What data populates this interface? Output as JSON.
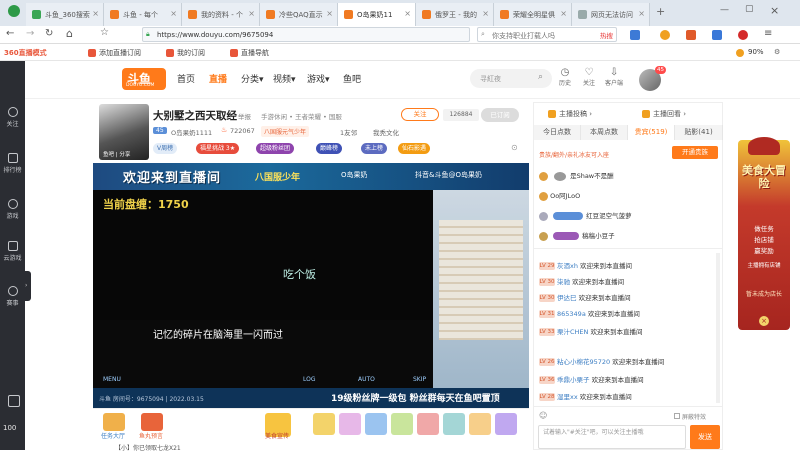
{
  "tabs": [
    {
      "label": "斗鱼_360搜索",
      "active": false,
      "color": "#3aa655"
    },
    {
      "label": "斗鱼 - 每个",
      "active": false,
      "color": "#f07a22"
    },
    {
      "label": "我的资料 - 个",
      "active": false,
      "color": "#f07a22"
    },
    {
      "label": "冷些QAQ直示",
      "active": false,
      "color": "#f07a22"
    },
    {
      "label": "O岛果奶11",
      "active": true,
      "color": "#f07a22"
    },
    {
      "label": "俄罗王 - 我的",
      "active": false,
      "color": "#f07a22"
    },
    {
      "label": "荣耀全明星俱",
      "active": false,
      "color": "#f07a22"
    },
    {
      "label": "网页无法访问",
      "active": false,
      "color": "#9aa"
    }
  ],
  "address": {
    "url": "https://www.douyu.com/9675094",
    "search_text": "你支持职业打载人吗",
    "search_hot": "热搜"
  },
  "bookmarks": [
    {
      "label": "360直播模式"
    },
    {
      "label": "添加直播订阅"
    },
    {
      "label": "我的订阅"
    },
    {
      "label": "直播导航"
    }
  ],
  "zoom": "90%",
  "left_sidebar": [
    {
      "label": "关注"
    },
    {
      "label": "排行榜"
    },
    {
      "label": "游戏"
    },
    {
      "label": "云游戏"
    },
    {
      "label": "赛事"
    }
  ],
  "sidebar_bottom": "100",
  "site": {
    "logo": "斗鱼",
    "logo_sub": "DOUYU.COM",
    "nav": [
      "首页",
      "直播",
      "分类▾",
      "视频▾",
      "游戏▾",
      "鱼吧"
    ],
    "search_placeholder": "寻紅夜",
    "icons": [
      "历史",
      "关注",
      "客户端"
    ],
    "avatar_badge": "45"
  },
  "room": {
    "title": "大别墅之西天取经",
    "report": "举报",
    "breadcrumb": "手游休闲 • 王者荣耀 • 国服",
    "streamer_level": "45",
    "streamer_name": "O岛果奶1111",
    "hot": "722067",
    "tag_rank": "八国服元气少年",
    "fan_club": "1友邻",
    "guild": "我秃文化",
    "follow_label": "关注",
    "follower_count": "126884",
    "followed_state": "已订阅",
    "badges": [
      "V周榜",
      "福星挑战 3★",
      "超级粉丝团",
      "巅峰榜",
      "未上榜",
      "仙石影遇"
    ],
    "streamer_tag": "鱼吧 | 分享"
  },
  "banner": {
    "main": "欢迎来到直播间",
    "right": "八国服少年",
    "tiktok": "O岛果奶",
    "douyu_id": "抖音&斗鱼@O岛果奶"
  },
  "video": {
    "gold": "当前盘缠：1750",
    "caption1": "吃个饭",
    "caption2": "记忆的碎片在脑海里一闪而过",
    "menu_items": [
      "MENU",
      "LOG",
      "AUTO",
      "SKIP"
    ]
  },
  "footbar": {
    "room_id": "斗鱼 房间号：9675094 | 2022.03.15",
    "slogan": "19级粉丝牌一级包  粉丝群每天在鱼吧置顶"
  },
  "gifts": {
    "left_items": [
      {
        "label": "任务大厅"
      },
      {
        "label": "鱼丸预言"
      }
    ],
    "mid_item": "美食宣传",
    "bottom_text": "【小】你已领取七龙X21"
  },
  "right_panel": {
    "top_tabs": [
      "主播投稿 ›",
      "主播回看 ›"
    ],
    "tabs": [
      "今日点数",
      "本周点数",
      "贵宾(519)",
      "贴影(41)"
    ],
    "banner_text": "贵族/翻外/亲礼冰友可入座",
    "open_vip": "开通贵族",
    "vips": [
      {
        "name": "是Shaw不是酬"
      },
      {
        "name": "Oo阿JLoO"
      },
      {
        "name": "红豆泥空气菠萝"
      },
      {
        "name": "稿稿小豆子"
      }
    ],
    "chat": [
      {
        "lvl": "LV 29",
        "name": "灰酒xh",
        "text": "欢迎来到本直播间"
      },
      {
        "lvl": "LV 30",
        "name": "柒驰",
        "text": "欢迎来到本直播间"
      },
      {
        "lvl": "LV 30",
        "name": "伊达巳",
        "text": "欢迎来到本直播间"
      },
      {
        "lvl": "LV 31",
        "name": "865349a",
        "text": "欢迎来到本直播间"
      },
      {
        "lvl": "LV 33",
        "name": "栗汁CHEN",
        "text": "欢迎来到本直播间"
      },
      {
        "lvl": "LV 26",
        "name": "粘心小棉花95720",
        "text": "欢迎来到本直播间"
      },
      {
        "lvl": "LV 36",
        "name": "乖鼎小栗子",
        "text": "欢迎来到本直播间"
      },
      {
        "lvl": "LV 28",
        "name": "湿里xx",
        "text": "欢迎来到本直播间"
      }
    ],
    "input_placeholder": "试着输入\"#关注\"吧，可以关注主播哦",
    "send_label": "发送",
    "toggle_label": "屏蔽特效"
  },
  "promo": {
    "title": "美食大冒险",
    "lines": [
      "做任务",
      "抢店铺",
      "赢奖励",
      "主播拥有店铺"
    ],
    "footer": "暂未成为店长"
  }
}
